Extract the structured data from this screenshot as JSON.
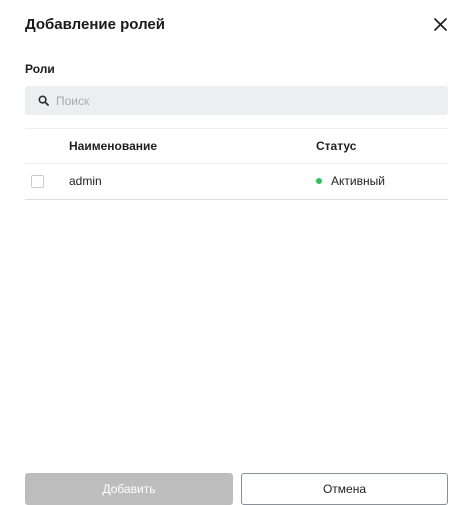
{
  "dialog": {
    "title": "Добавление ролей",
    "close_icon": "close-icon"
  },
  "roles": {
    "label": "Роли"
  },
  "search": {
    "icon": "search-icon",
    "placeholder": "Поиск",
    "value": ""
  },
  "table": {
    "columns": [
      "Наименование",
      "Статус"
    ],
    "rows": [
      {
        "checked": false,
        "name": "admin",
        "status": "Активный",
        "status_color": "#2fbf5b"
      }
    ]
  },
  "footer": {
    "add_label": "Добавить",
    "cancel_label": "Отмена"
  },
  "colors": {
    "add_button_disabled": "#bdbdbd",
    "search_background": "#eceef1",
    "status_active": "#2fbf5b"
  }
}
